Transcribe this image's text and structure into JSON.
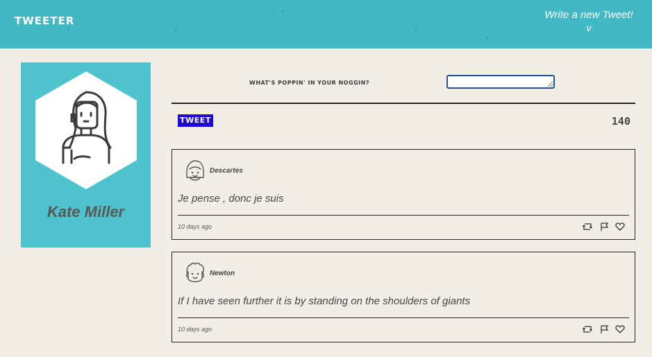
{
  "header": {
    "brand": "TWEETER",
    "compose_link": "Write a new Tweet!",
    "compose_arrow": "v"
  },
  "profile": {
    "name": "Kate Miller",
    "avatar_icon": "woman-avatar-icon"
  },
  "composer": {
    "label": "WHAT'S POPPIN' IN YOUR NOGGIN?",
    "input_value": "",
    "submit_label": "TWEET",
    "char_count": "140"
  },
  "tweets": [
    {
      "author": "Descartes",
      "avatar_icon": "girl-avatar-icon",
      "text": "Je pense , donc je suis",
      "time": "10 days ago"
    },
    {
      "author": "Newton",
      "avatar_icon": "curly-hair-avatar-icon",
      "text": "If I have seen further it is by standing on the shoulders of giants",
      "time": "10 days ago"
    }
  ],
  "colors": {
    "header_bg": "#40b9c4",
    "profile_bg": "#4ec3cd",
    "page_bg": "#f1eee8",
    "button_bg": "#1e06d8"
  }
}
